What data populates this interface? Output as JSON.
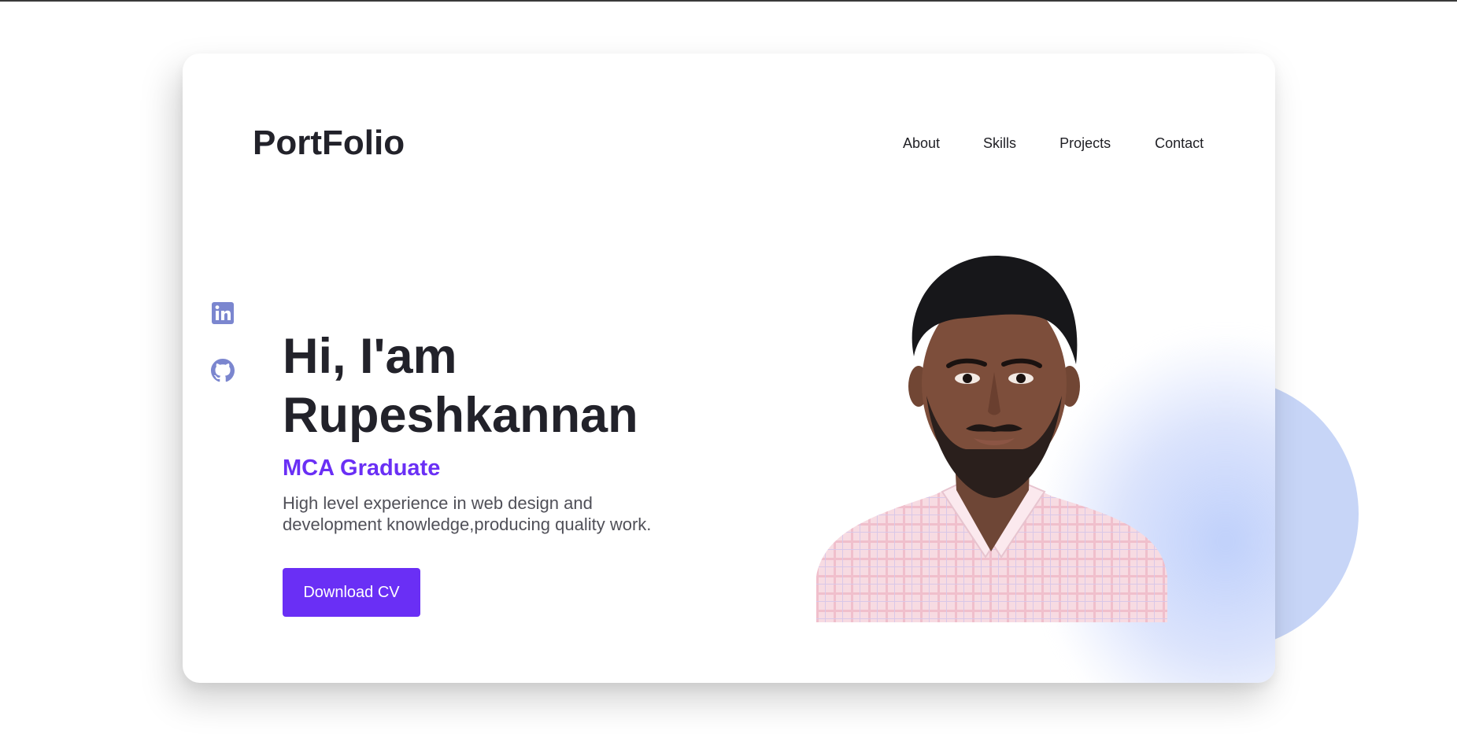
{
  "header": {
    "logo": "PortFolio",
    "nav": [
      "About",
      "Skills",
      "Projects",
      "Contact"
    ]
  },
  "social": [
    "linkedin-icon",
    "github-icon"
  ],
  "hero": {
    "title_line1": "Hi, I'am",
    "title_line2": "Rupeshkannan",
    "subtitle": "MCA Graduate",
    "description_line1": "High level experience in web design and",
    "description_line2": "development knowledge,producing quality work.",
    "cta_label": "Download CV"
  },
  "colors": {
    "accent": "#6a2ff5",
    "heading": "#22222a",
    "body_text": "#505058",
    "social_icon": "#7b86cf",
    "blob": "#c7d5f7"
  }
}
